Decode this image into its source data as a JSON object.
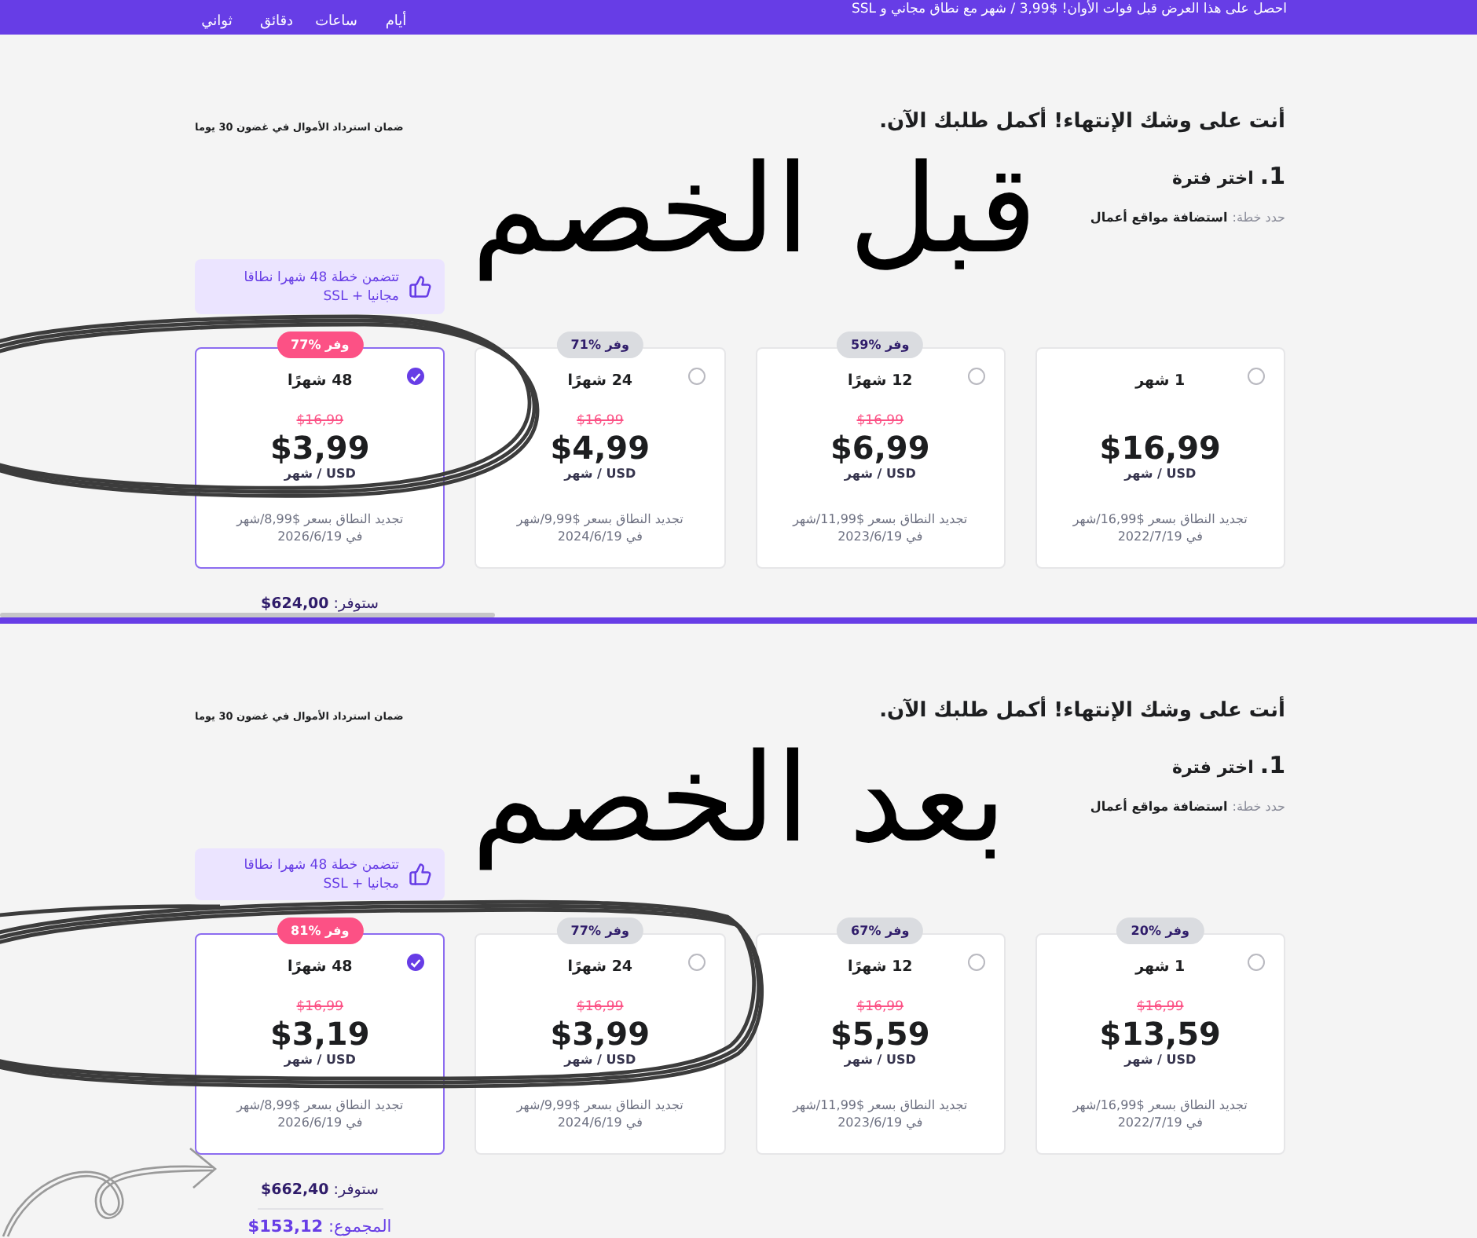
{
  "banner": {
    "message": "احصل على هذا العرض قبل فوات الأوان! $3,99 / شهر مع نطاق مجاني و SSL",
    "countdown": [
      "أيام",
      "ساعات",
      "دقائق",
      "ثواني"
    ]
  },
  "sections": [
    {
      "heading": "أنت على وشك الإنتهاء! أكمل طلبك الآن.",
      "guarantee": "ضمان استرداد الأموال في غضون 30 يوما",
      "step": {
        "number": "1.",
        "title": "اختر فترة"
      },
      "plan": {
        "label": "حدد خطة:",
        "value": "استضافة مواقع أعمال"
      },
      "promo": "تتضمن خطة 48 شهرا نطاقا مجانيا + SSL",
      "periods": [
        {
          "title": "1 شهر",
          "price": "$16,99",
          "unit": "USD / شهر",
          "renewal": [
            "تجديد النطاق بسعر $16,99/شهر",
            "في 2022/7/19"
          ],
          "selected": false
        },
        {
          "badge": "وفر %59",
          "title": "12 شهرًا",
          "old_price": "$16,99",
          "price": "$6,99",
          "unit": "USD / شهر",
          "renewal": [
            "تجديد النطاق بسعر $11,99/شهر",
            "في 2023/6/19"
          ],
          "selected": false
        },
        {
          "badge": "وفر %71",
          "title": "24 شهرًا",
          "old_price": "$16,99",
          "price": "$4,99",
          "unit": "USD / شهر",
          "renewal": [
            "تجديد النطاق بسعر $9,99/شهر",
            "في 2024/6/19"
          ],
          "selected": false
        },
        {
          "badge": "وفر %77",
          "title": "48 شهرًا",
          "old_price": "$16,99",
          "price": "$3,99",
          "unit": "USD / شهر",
          "renewal": [
            "تجديد النطاق بسعر $8,99/شهر",
            "في 2026/6/19"
          ],
          "selected": true
        }
      ],
      "savings": "ستوفر: **624,00$**",
      "horizontal_scrollbar": true,
      "annotation": {
        "text": "قبل الخصم"
      }
    },
    {
      "heading": "أنت على وشك الإنتهاء! أكمل طلبك الآن.",
      "guarantee": "ضمان استرداد الأموال في غضون 30 يوما",
      "step": {
        "number": "1.",
        "title": "اختر فترة"
      },
      "plan": {
        "label": "حدد خطة:",
        "value": "استضافة مواقع أعمال"
      },
      "promo": "تتضمن خطة 48 شهرا نطاقا مجانيا + SSL",
      "periods": [
        {
          "badge": "وفر %20",
          "title": "1 شهر",
          "old_price": "$16,99",
          "price": "$13,59",
          "unit": "USD / شهر",
          "renewal": [
            "تجديد النطاق بسعر $16,99/شهر",
            "في 2022/7/19"
          ],
          "selected": false
        },
        {
          "badge": "وفر %67",
          "title": "12 شهرًا",
          "old_price": "$16,99",
          "price": "$5,59",
          "unit": "USD / شهر",
          "renewal": [
            "تجديد النطاق بسعر $11,99/شهر",
            "في 2023/6/19"
          ],
          "selected": false
        },
        {
          "badge": "وفر %77",
          "title": "24 شهرًا",
          "old_price": "$16,99",
          "price": "$3,99",
          "unit": "USD / شهر",
          "renewal": [
            "تجديد النطاق بسعر $9,99/شهر",
            "في 2024/6/19"
          ],
          "selected": false
        },
        {
          "badge": "وفر %81",
          "title": "48 شهرًا",
          "old_price": "$16,99",
          "price": "$3,19",
          "unit": "USD / شهر",
          "renewal": [
            "تجديد النطاق بسعر $8,99/شهر",
            "في 2026/6/19"
          ],
          "selected": true
        }
      ],
      "savings": "ستوفر: **662,40$**",
      "total": "المجموع: **153,12$**",
      "annotation": {
        "text": "بعد الخصم",
        "arrow": true
      }
    }
  ]
}
